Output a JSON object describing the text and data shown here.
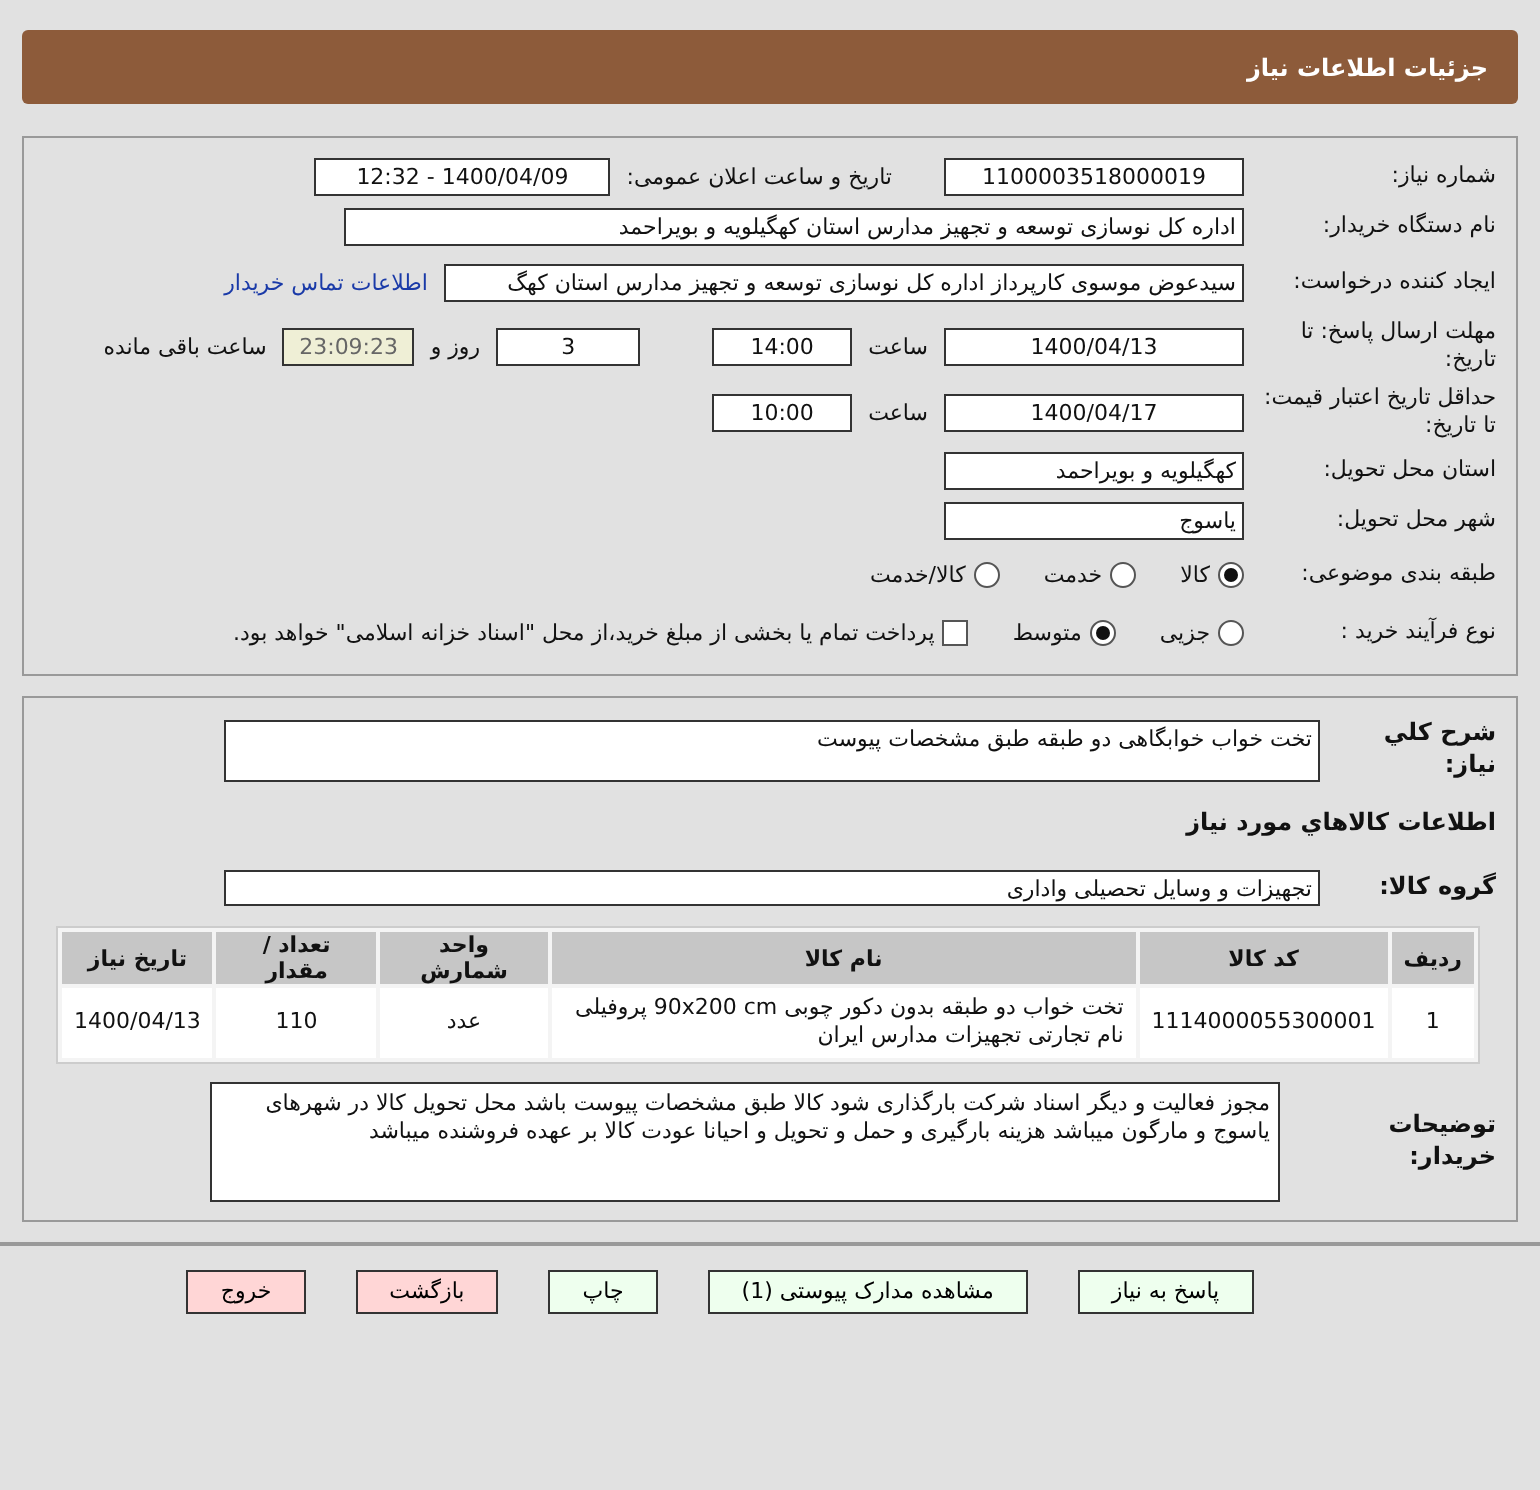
{
  "header": {
    "title": "جزئیات اطلاعات نیاز"
  },
  "need_info": {
    "need_number_label": "شماره نیاز:",
    "need_number": "1100003518000019",
    "announce_label": "تاریخ و ساعت اعلان عمومی:",
    "announce_value": "1400/04/09 - 12:32",
    "buyer_label": "نام دستگاه خریدار:",
    "buyer": "اداره کل نوسازی  توسعه و تجهیز مدارس استان کهگیلویه و بویراحمد",
    "creator_label": "ایجاد کننده درخواست:",
    "creator": "سیدعوض موسوی کارپرداز اداره کل نوسازی  توسعه و تجهیز مدارس استان کهگ",
    "contact_link": "اطلاعات تماس خریدار",
    "deadline_label": "مهلت ارسال پاسخ: تا تاریخ:",
    "deadline_date": "1400/04/13",
    "time_label": "ساعت",
    "deadline_time": "14:00",
    "days": "3",
    "days_label": "روز و",
    "remaining": "23:09:23",
    "remaining_label": "ساعت باقی مانده",
    "validity_label": "حداقل تاریخ اعتبار قیمت: تا تاریخ:",
    "validity_date": "1400/04/17",
    "validity_time_label": "ساعت",
    "validity_time": "10:00",
    "province_label": "استان محل تحویل:",
    "province": "کهگیلویه و بویراحمد",
    "city_label": "شهر محل تحویل:",
    "city": "یاسوج",
    "category_label": "طبقه بندی موضوعی:",
    "category_options": [
      {
        "label": "کالا",
        "selected": true
      },
      {
        "label": "خدمت",
        "selected": false
      },
      {
        "label": "کالا/خدمت",
        "selected": false
      }
    ],
    "process_label": "نوع فرآیند خرید :",
    "process_options": [
      {
        "label": "جزیی",
        "selected": false
      },
      {
        "label": "متوسط",
        "selected": true
      }
    ],
    "treasury": {
      "label": "پرداخت تمام یا بخشی از مبلغ خرید،از محل \"اسناد خزانه اسلامی\" خواهد بود.",
      "checked": false
    }
  },
  "details": {
    "description_label": "شرح کلي نياز:",
    "description": "تخت خواب خوابگاهی دو طبقه طبق مشخصات پیوست",
    "goods_heading": "اطلاعات کالاهاي مورد نياز",
    "group_label": "گروه کالا:",
    "group": "تجهیزات و وسایل تحصیلی واداری",
    "table": {
      "columns": [
        "ردیف",
        "کد کالا",
        "نام کالا",
        "واحد شمارش",
        "تعداد / مقدار",
        "تاریخ نیاز"
      ],
      "rows": [
        [
          "1",
          "1114000055300001",
          "تخت خواب دو طبقه بدون دکور چوبی 90x200 cm پروفیلی نام تجارتی تجهیزات مدارس ایران",
          "عدد",
          "110",
          "1400/04/13"
        ]
      ]
    },
    "notes_label": "توضیحات خریدار:",
    "notes": "مجوز فعالیت و دیگر اسناد شرکت بارگذاری شود  کالا طبق مشخصات پیوست باشد    محل تحویل کالا در شهرهای یاسوج و مارگون میباشد  هزینه بارگیری و حمل و تحویل و احیانا عودت کالا بر عهده فروشنده میباشد"
  },
  "buttons": [
    {
      "label": "پاسخ به نیاز",
      "kind": "primary"
    },
    {
      "label": "مشاهده مدارک پیوستی (1)",
      "kind": "primary"
    },
    {
      "label": "چاپ",
      "kind": "primary"
    },
    {
      "label": "بازگشت",
      "kind": "danger"
    },
    {
      "label": "خروج",
      "kind": "danger"
    }
  ]
}
